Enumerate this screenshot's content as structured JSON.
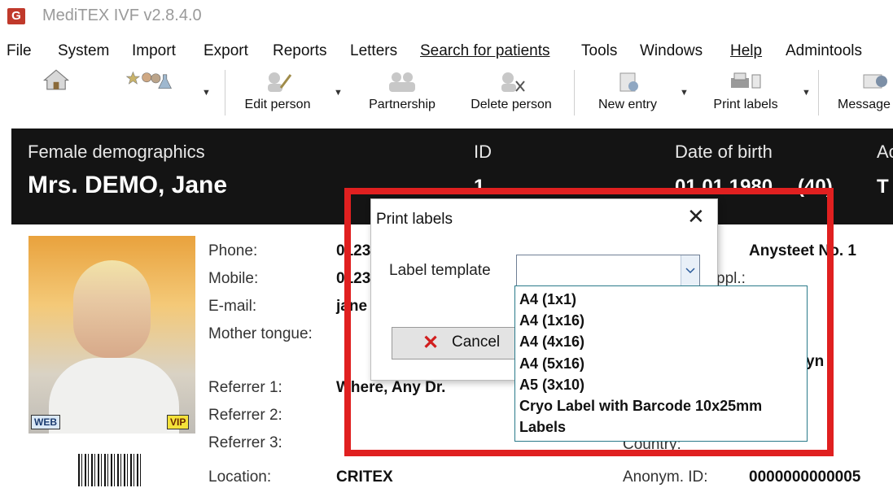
{
  "window": {
    "title": "MediTEX IVF v2.8.4.0"
  },
  "menu": [
    "File",
    "System",
    "Import",
    "Export",
    "Reports",
    "Letters",
    "Search for patients",
    "Tools",
    "Windows",
    "Help",
    "Admintools"
  ],
  "toolbar": {
    "edit_person": "Edit person",
    "partnership": "Partnership",
    "delete_person": "Delete person",
    "new_entry": "New entry",
    "print_labels": "Print labels",
    "messages": "Message"
  },
  "demographics": {
    "section_label": "Female demographics",
    "name": "Mrs. DEMO, Jane",
    "id_label": "ID",
    "id_value": "1",
    "dob_label": "Date of birth",
    "dob_value": "01.01.1980",
    "age_value": "(40)",
    "extra_label": "Ac",
    "extra_value": "T"
  },
  "patient": {
    "phone_label": "Phone:",
    "phone_value": "0123",
    "mobile_label": "Mobile:",
    "mobile_value": "0123",
    "email_label": "E-mail:",
    "email_value": "jane",
    "mother_tongue_label": "Mother tongue:",
    "referrer1_label": "Referrer 1:",
    "referrer1_value": "Where, Any Dr.",
    "referrer2_label": "Referrer 2:",
    "referrer3_label": "Referrer 3:",
    "location_label": "Location:",
    "location_value": "CRITEX",
    "street_value": "Anysteet No. 1",
    "addr_suffix": "ppl.:",
    "city_suffix": "yn",
    "country_label": "Country:",
    "anonym_label": "Anonym. ID:",
    "anonym_value": "0000000000005",
    "badge_web": "WEB",
    "badge_vip": "VIP"
  },
  "dialog": {
    "title": "Print labels",
    "template_label": "Label template",
    "template_value": "",
    "cancel": "Cancel"
  },
  "dropdown_options": [
    "A4 (1x1)",
    "A4 (1x16)",
    "A4 (4x16)",
    "A4 (5x16)",
    "A5 (3x10)",
    "Cryo Label with Barcode 10x25mm",
    "Labels"
  ],
  "colors": {
    "highlight": "#e02020",
    "header_bg": "#141414",
    "cancel_icon": "#d11e1e"
  }
}
